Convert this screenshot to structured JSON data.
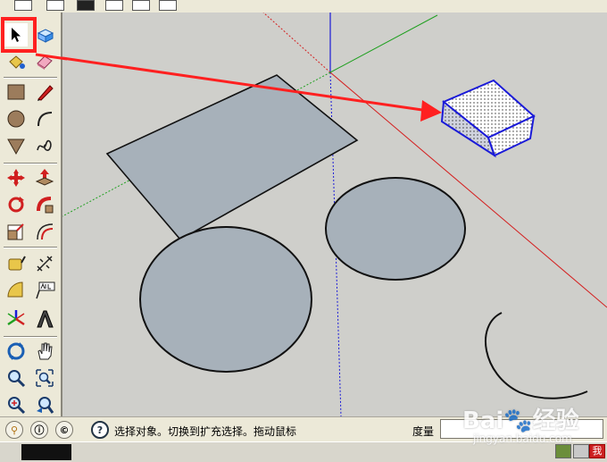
{
  "status": {
    "hint": "选择对象。切换到扩充选择。拖动鼠标",
    "measure_label": "度量",
    "measure_value": ""
  },
  "watermark": {
    "brand": "Bai",
    "brand_suffix": "经验",
    "sub": "jingyan.baidu.com"
  },
  "taskbar": {
    "tray_text": "我"
  },
  "colors": {
    "viewport_bg": "#cfcfcb",
    "face_fill": "#a7b1ba",
    "highlight_red": "#ff2020",
    "selection_blue": "#1a1ad8",
    "axis_red": "#d42020",
    "axis_green": "#20a020",
    "axis_blue": "#1a1ad8"
  },
  "tools": [
    "select-tool",
    "component-tool",
    "paint-bucket-tool",
    "eraser-tool",
    "rectangle-tool",
    "line-tool",
    "circle-tool",
    "arc-tool",
    "polygon-tool",
    "freehand-tool",
    "move-tool",
    "push-pull-tool",
    "rotate-tool",
    "follow-me-tool",
    "scale-tool",
    "offset-tool",
    "tape-measure-tool",
    "dimension-tool",
    "protractor-tool",
    "text-tool",
    "axes-tool",
    "3d-text-tool",
    "orbit-tool",
    "pan-tool",
    "zoom-tool",
    "zoom-window-tool",
    "zoom-extents-tool",
    "previous-view-tool"
  ]
}
